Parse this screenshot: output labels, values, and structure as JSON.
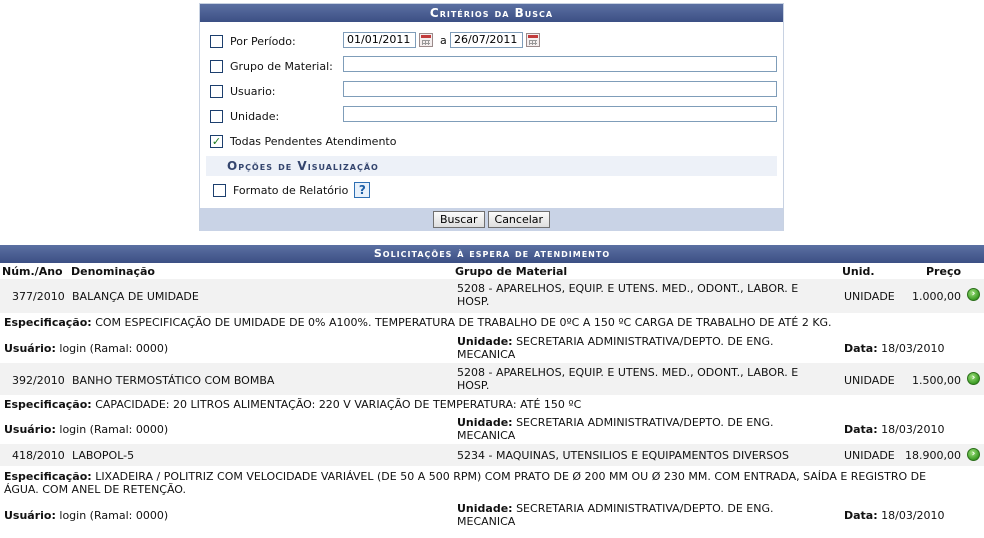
{
  "criteria": {
    "title": "Critérios da Busca",
    "period_label": "Por Período:",
    "date_from": "01/01/2011",
    "date_sep": "a",
    "date_to": "26/07/2011",
    "grupo_label": "Grupo de Material:",
    "usuario_label": "Usuario:",
    "unidade_label": "Unidade:",
    "pendentes_label": "Todas Pendentes Atendimento",
    "pendentes_checked": true,
    "options_title": "Opções de Visualização",
    "formato_label": "Formato de Relatório",
    "help_glyph": "?",
    "buscar_label": "Buscar",
    "cancelar_label": "Cancelar"
  },
  "results": {
    "title": "Solicitações à espera de atendimento",
    "headers": {
      "num": "Núm./Ano",
      "denominacao": "Denominação",
      "grupo": "Grupo de Material",
      "unid": "Unid.",
      "preco": "Preço"
    },
    "spec_label": "Especificação:",
    "usuario_label": "Usuário:",
    "unidade_label": "Unidade:",
    "data_label": "Data:",
    "items": [
      {
        "num": "377/2010",
        "denominacao": "BALANÇA DE UMIDADE",
        "grupo_1": "5208 - APARELHOS, EQUIP. E UTENS. MED., ODONT., LABOR. E",
        "grupo_2": "HOSP.",
        "unid": "UNIDADE",
        "preco": "1.000,00",
        "spec_1": "COM ESPECIFICAÇÃO DE UMIDADE DE 0% A100%. TEMPERATURA DE TRABALHO DE 0ºC A 150 ºC CARGA DE TRABALHO DE ATÉ 2 KG.",
        "spec_2": "",
        "usuario": "login (Ramal: 0000)",
        "unidade_1": "SECRETARIA ADMINISTRATIVA/DEPTO. DE ENG.",
        "unidade_2": "MECANICA",
        "data": "18/03/2010"
      },
      {
        "num": "392/2010",
        "denominacao": "BANHO TERMOSTÁTICO COM BOMBA",
        "grupo_1": "5208 - APARELHOS, EQUIP. E UTENS. MED., ODONT., LABOR. E",
        "grupo_2": "HOSP.",
        "unid": "UNIDADE",
        "preco": "1.500,00",
        "spec_1": "CAPACIDADE: 20 LITROS ALIMENTAÇÃO: 220 V VARIAÇÃO DE TEMPERATURA: ATÉ 150 ºC",
        "spec_2": "",
        "usuario": "login (Ramal: 0000)",
        "unidade_1": "SECRETARIA ADMINISTRATIVA/DEPTO. DE ENG.",
        "unidade_2": "MECANICA",
        "data": "18/03/2010"
      },
      {
        "num": "418/2010",
        "denominacao": "LABOPOL-5",
        "grupo_1": "5234 - MAQUINAS, UTENSILIOS E EQUIPAMENTOS DIVERSOS",
        "grupo_2": "",
        "unid": "UNIDADE",
        "preco": "18.900,00",
        "spec_1": "LIXADEIRA / POLITRIZ COM VELOCIDADE VARIÁVEL (DE 50 A 500 RPM) COM PRATO DE Ø 200 MM OU Ø 230 MM. COM ENTRADA, SAÍDA E REGISTRO DE",
        "spec_2": "ÁGUA. COM ANEL DE RETENÇÃO.",
        "usuario": "login (Ramal: 0000)",
        "unidade_1": "SECRETARIA ADMINISTRATIVA/DEPTO. DE ENG.",
        "unidade_2": "MECANICA",
        "data": "18/03/2010"
      }
    ]
  }
}
